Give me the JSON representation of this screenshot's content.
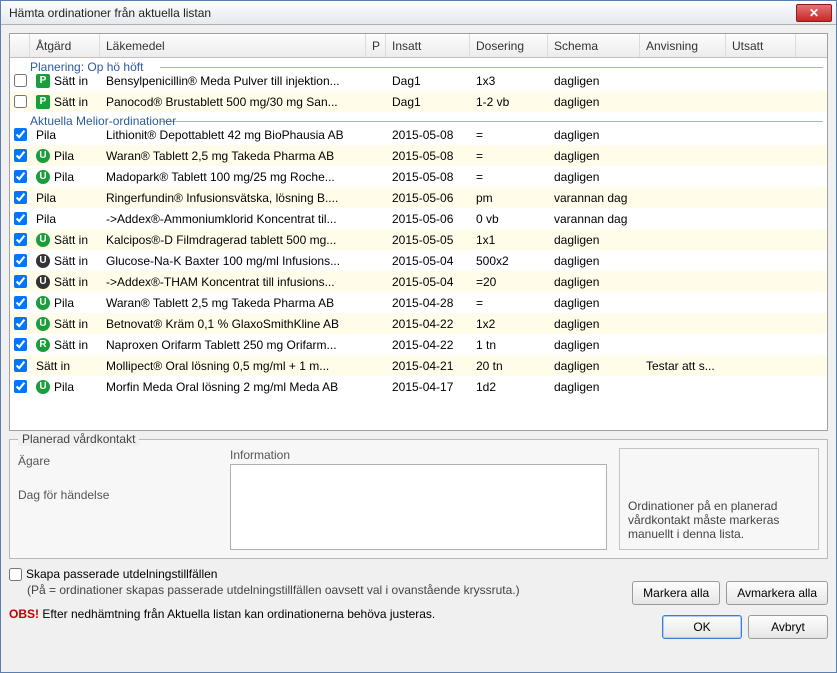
{
  "window": {
    "title": "Hämta ordinationer från aktuella listan",
    "close": "✕"
  },
  "columns": {
    "action": "Åtgärd",
    "med": "Läkemedel",
    "p": "P",
    "insatt": "Insatt",
    "dos": "Dosering",
    "schema": "Schema",
    "anv": "Anvisning",
    "utsatt": "Utsatt"
  },
  "groups": [
    {
      "title": "Planering: Op hö höft",
      "rows": [
        {
          "checked": false,
          "badges": [
            "P"
          ],
          "action": "Sätt in",
          "med": "Bensylpenicillin® Meda Pulver till injektion...",
          "insatt": "Dag1",
          "dos": "1x3",
          "schema": "dagligen",
          "anv": "",
          "alt": false
        },
        {
          "checked": false,
          "badges": [
            "P"
          ],
          "action": "Sätt in",
          "med": "Panocod® Brustablett 500 mg/30 mg San...",
          "insatt": "Dag1",
          "dos": "1-2 vb",
          "schema": "dagligen",
          "anv": "",
          "alt": true
        }
      ]
    },
    {
      "title": "Aktuella Melior-ordinationer",
      "rows": [
        {
          "checked": true,
          "badges": [],
          "action": "Pila",
          "med": "Lithionit® Depottablett 42 mg BioPhausia AB",
          "insatt": "2015-05-08",
          "dos": "=",
          "schema": "dagligen",
          "anv": "",
          "alt": false
        },
        {
          "checked": true,
          "badges": [
            "Up"
          ],
          "action": "Pila",
          "med": "Waran® Tablett 2,5 mg Takeda Pharma AB",
          "insatt": "2015-05-08",
          "dos": "=",
          "schema": "dagligen",
          "anv": "",
          "alt": true
        },
        {
          "checked": true,
          "badges": [
            "Up"
          ],
          "action": "Pila",
          "med": "Madopark® Tablett 100 mg/25 mg Roche...",
          "insatt": "2015-05-08",
          "dos": "=",
          "schema": "dagligen",
          "anv": "",
          "alt": false
        },
        {
          "checked": true,
          "badges": [],
          "action": "Pila",
          "med": "Ringerfundin® Infusionsvätska, lösning B....",
          "insatt": "2015-05-06",
          "dos": "pm",
          "schema": "varannan dag",
          "anv": "",
          "alt": true
        },
        {
          "checked": true,
          "badges": [],
          "action": "Pila",
          "med": "->Addex®-Ammoniumklorid Koncentrat til...",
          "insatt": "2015-05-06",
          "dos": "0 vb",
          "schema": "varannan dag",
          "anv": "",
          "alt": false
        },
        {
          "checked": true,
          "badges": [
            "Up"
          ],
          "action": "Sätt in",
          "med": "Kalcipos®-D Filmdragerad tablett 500 mg...",
          "insatt": "2015-05-05",
          "dos": "1x1",
          "schema": "dagligen",
          "anv": "",
          "alt": true
        },
        {
          "checked": true,
          "badges": [
            "U"
          ],
          "action": "Sätt in",
          "med": "Glucose-Na-K Baxter 100 mg/ml Infusions...",
          "insatt": "2015-05-04",
          "dos": "500x2",
          "schema": "dagligen",
          "anv": "",
          "alt": false
        },
        {
          "checked": true,
          "badges": [
            "U"
          ],
          "action": "Sätt in",
          "med": "->Addex®-THAM Koncentrat till infusions...",
          "insatt": "2015-05-04",
          "dos": "=20",
          "schema": "dagligen",
          "anv": "",
          "alt": true
        },
        {
          "checked": true,
          "badges": [
            "Up"
          ],
          "action": "Pila",
          "med": "Waran® Tablett 2,5 mg Takeda Pharma AB",
          "insatt": "2015-04-28",
          "dos": "=",
          "schema": "dagligen",
          "anv": "",
          "alt": false
        },
        {
          "checked": true,
          "badges": [
            "Up"
          ],
          "action": "Sätt in",
          "med": "Betnovat® Kräm 0,1 % GlaxoSmithKline AB",
          "insatt": "2015-04-22",
          "dos": "1x2",
          "schema": "dagligen",
          "anv": "",
          "alt": true
        },
        {
          "checked": true,
          "badges": [
            "R"
          ],
          "action": "Sätt in",
          "med": "Naproxen Orifarm Tablett 250 mg Orifarm...",
          "insatt": "2015-04-22",
          "dos": "1 tn",
          "schema": "dagligen",
          "anv": "",
          "alt": false
        },
        {
          "checked": true,
          "badges": [],
          "action": "Sätt in",
          "med": "Mollipect® Oral lösning 0,5 mg/ml + 1 m...",
          "insatt": "2015-04-21",
          "dos": "20 tn",
          "schema": "dagligen",
          "anv": "Testar att s...",
          "alt": true
        },
        {
          "checked": true,
          "badges": [
            "Up"
          ],
          "action": "Pila",
          "med": "Morfin Meda Oral lösning 2 mg/ml Meda AB",
          "insatt": "2015-04-17",
          "dos": "1d2",
          "schema": "dagligen",
          "anv": "",
          "alt": false
        }
      ]
    }
  ],
  "panel": {
    "title": "Planerad vårdkontakt",
    "owner": "Ägare",
    "day": "Dag för händelse",
    "info": "Information",
    "note": "Ordinationer på en planerad vårdkontakt måste markeras manuellt i denna lista."
  },
  "bottom": {
    "skapa": "Skapa passerade utdelningstillfällen",
    "sub": "(På = ordinationer skapas passerade utdelningstillfällen oavsett val i ovanstående kryssruta.)",
    "obs_label": "OBS!",
    "obs_text": "  Efter nedhämtning från Aktuella listan kan ordinationerna behöva justeras."
  },
  "buttons": {
    "markAll": "Markera alla",
    "unmarkAll": "Avmarkera alla",
    "ok": "OK",
    "cancel": "Avbryt"
  },
  "badge_letters": {
    "P": "P",
    "U": "U",
    "Up": "U",
    "R": "R"
  }
}
